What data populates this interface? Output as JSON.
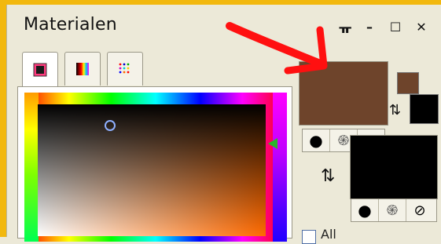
{
  "window": {
    "title": "Materialen",
    "controls": [
      "pin-icon",
      "minimize-icon",
      "maximize-icon",
      "close-icon"
    ],
    "control_labels": {
      "pin": "ᚂ",
      "minimize": "–",
      "maximize": "☐",
      "close": "✕"
    }
  },
  "tabs": [
    {
      "name": "frames-tab",
      "icon": "gradient-square-icon",
      "active": true
    },
    {
      "name": "rainbow-tab",
      "icon": "rainbow-square-icon",
      "active": false
    },
    {
      "name": "swatches-tab",
      "icon": "dots-grid-icon",
      "active": false
    }
  ],
  "colors": {
    "foreground": "#6e442b",
    "background": "#000000",
    "accent_arrow": "#ff1010",
    "hue_marker": "#2bb52b",
    "selection_border": "#9a9787"
  },
  "style_modes": [
    "solid-circle-icon",
    "spiral-icon",
    "prohibited-icon"
  ],
  "mode_glyphs": [
    "●",
    "֍",
    "⊘"
  ],
  "swap_glyph": "⇅",
  "checkbox": {
    "label": "All",
    "checked": false
  }
}
